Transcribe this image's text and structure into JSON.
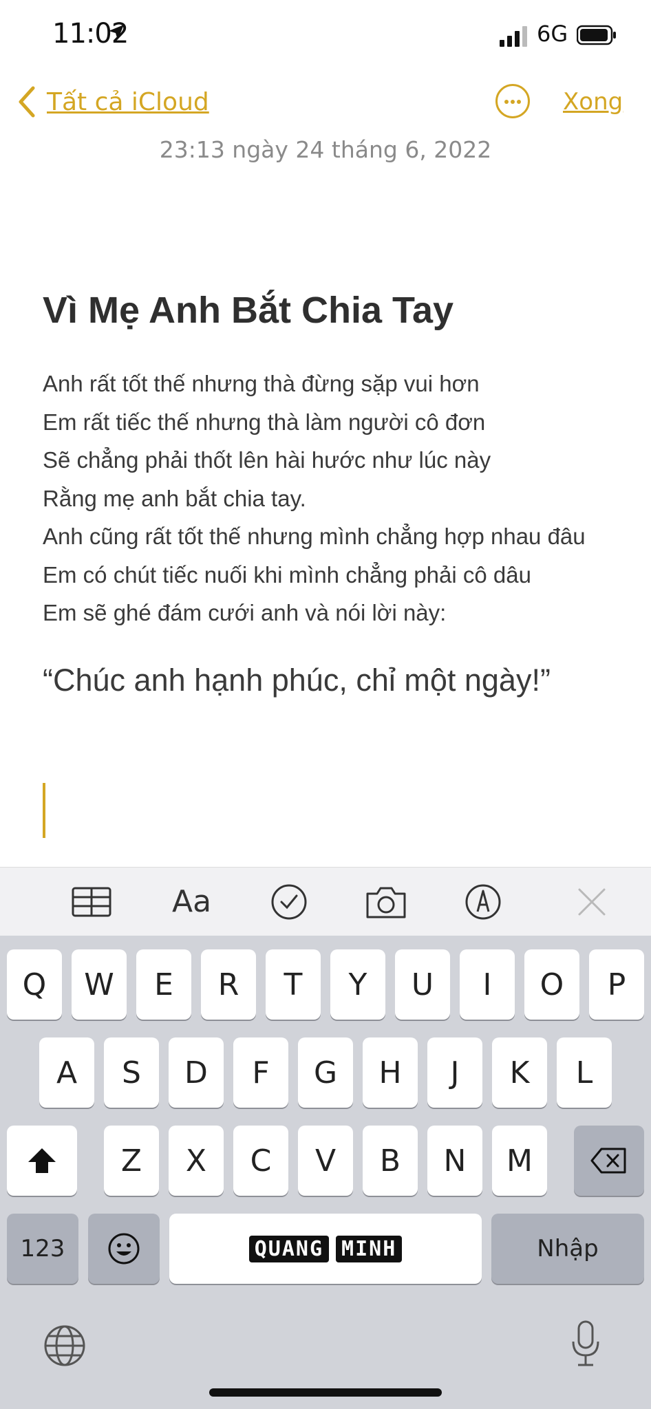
{
  "status_bar": {
    "time": "11:02",
    "network": "6G"
  },
  "nav": {
    "back_label": "Tất cả iCloud",
    "done_label": "Xong"
  },
  "note": {
    "date": "23:13 ngày 24 tháng 6, 2022",
    "title": "Vì Mẹ Anh Bắt Chia Tay",
    "lines": [
      "Anh rất tốt thế nhưng thà đừng sặp vui hơn",
      "Em rất tiếc thế nhưng thà làm người cô đơn",
      "Sẽ chẳng phải thốt lên hài hước như lúc này",
      "Rằng mẹ anh bắt chia tay.",
      "Anh cũng rất tốt thế nhưng mình chẳng hợp nhau đâu",
      "Em có chút tiếc nuối khi mình chẳng phải cô dâu",
      "Em sẽ ghé đám cưới anh và nói lời này:"
    ],
    "quote": "“Chúc anh hạnh phúc, chỉ một ngày!”"
  },
  "toolbar": {
    "format_label": "Aa"
  },
  "keyboard": {
    "row1": [
      "Q",
      "W",
      "E",
      "R",
      "T",
      "Y",
      "U",
      "I",
      "O",
      "P"
    ],
    "row2": [
      "A",
      "S",
      "D",
      "F",
      "G",
      "H",
      "J",
      "K",
      "L"
    ],
    "row3": [
      "Z",
      "X",
      "C",
      "V",
      "B",
      "N",
      "M"
    ],
    "numbers_label": "123",
    "space_brand": [
      "QUANG",
      "MINH"
    ],
    "return_label": "Nhập"
  },
  "colors": {
    "accent": "#d4a623",
    "keyboard_bg": "#d1d3d9",
    "toolbar_bg": "#f1f1f3"
  }
}
